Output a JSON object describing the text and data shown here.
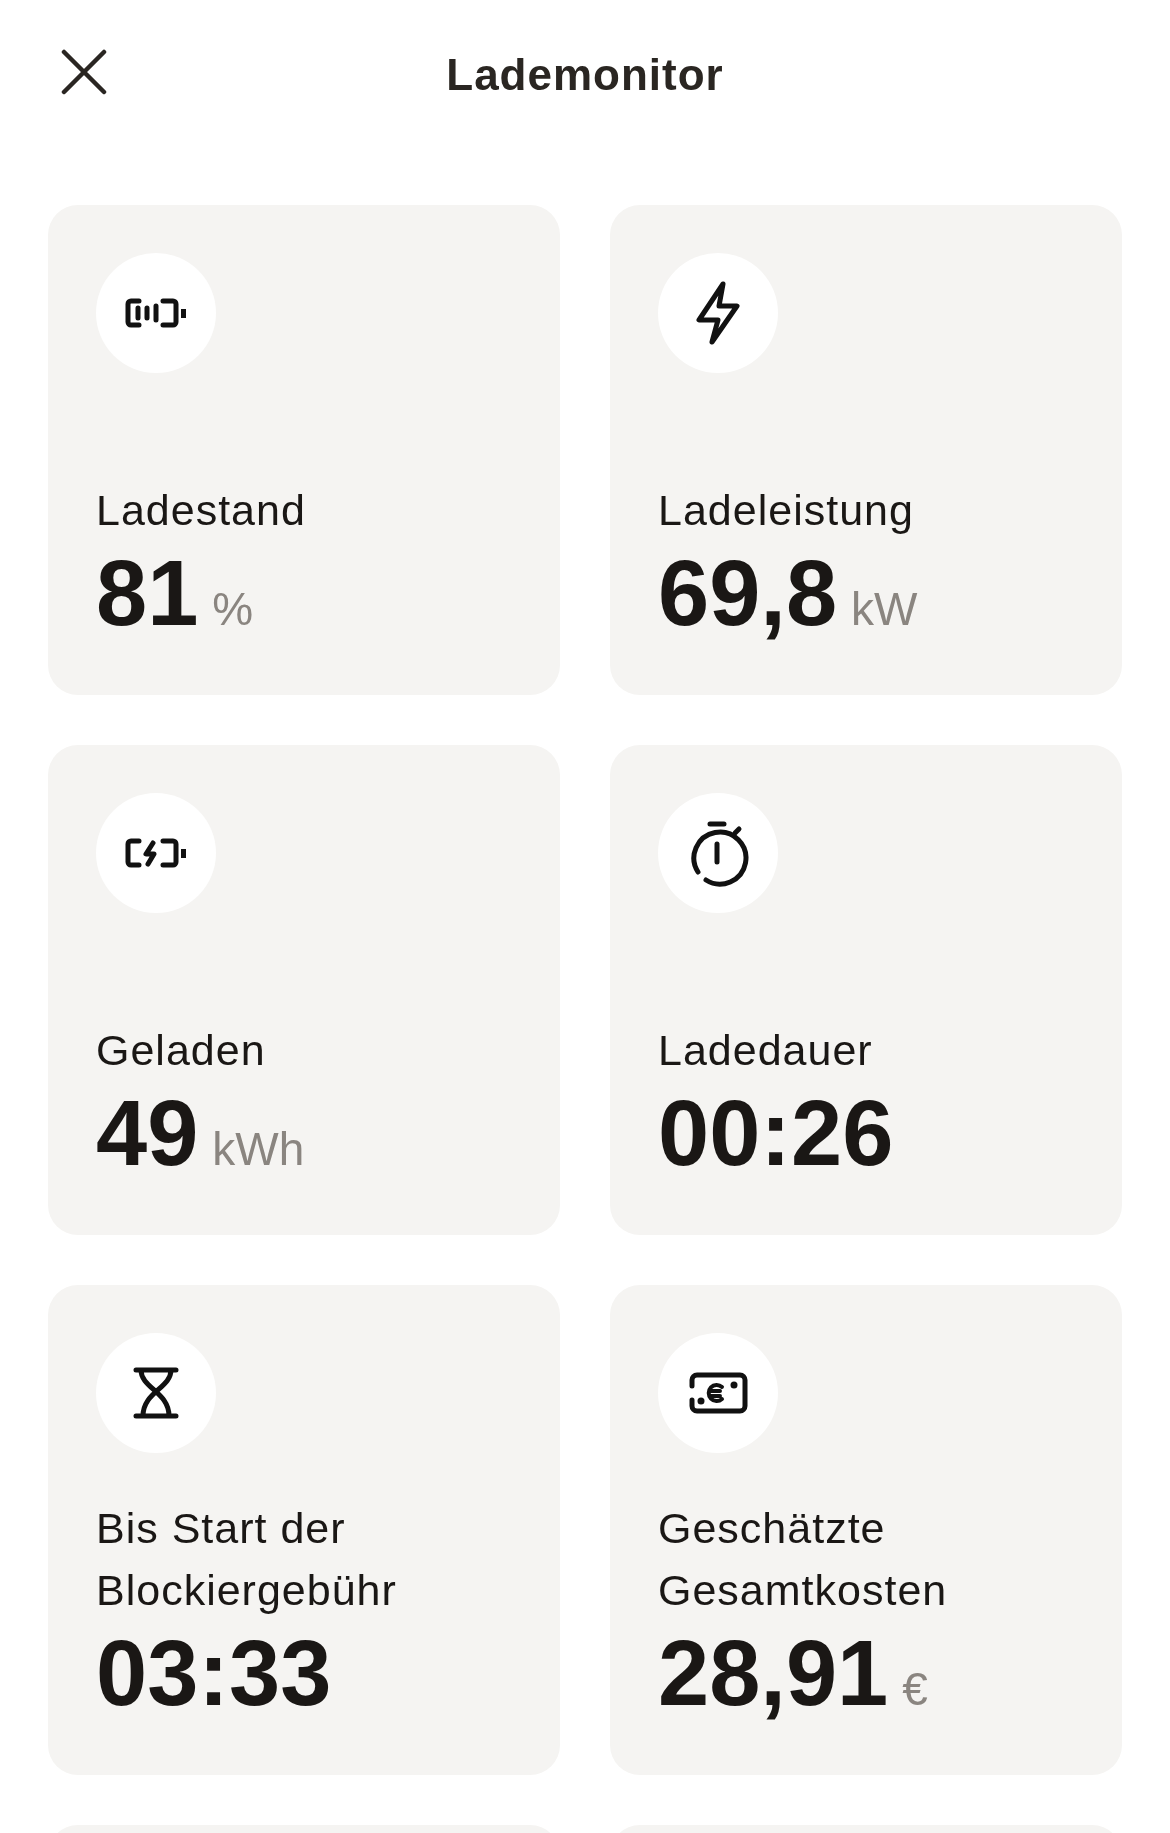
{
  "header": {
    "title": "Lademonitor"
  },
  "cards": [
    {
      "kind": "battery",
      "label": "Ladestand",
      "value": "81",
      "unit": "%"
    },
    {
      "kind": "power",
      "label": "Ladeleistung",
      "value": "69,8",
      "unit": "kW"
    },
    {
      "kind": "charged",
      "label": "Geladen",
      "value": "49",
      "unit": "kWh"
    },
    {
      "kind": "duration",
      "label": "Ladedauer",
      "value": "00:26"
    },
    {
      "kind": "blocking",
      "label": "Bis Start der Blockiergebühr",
      "value": "03:33"
    },
    {
      "kind": "cost",
      "label": "Geschätzte Gesamtkosten",
      "value": "28,91",
      "unit": "€"
    }
  ]
}
